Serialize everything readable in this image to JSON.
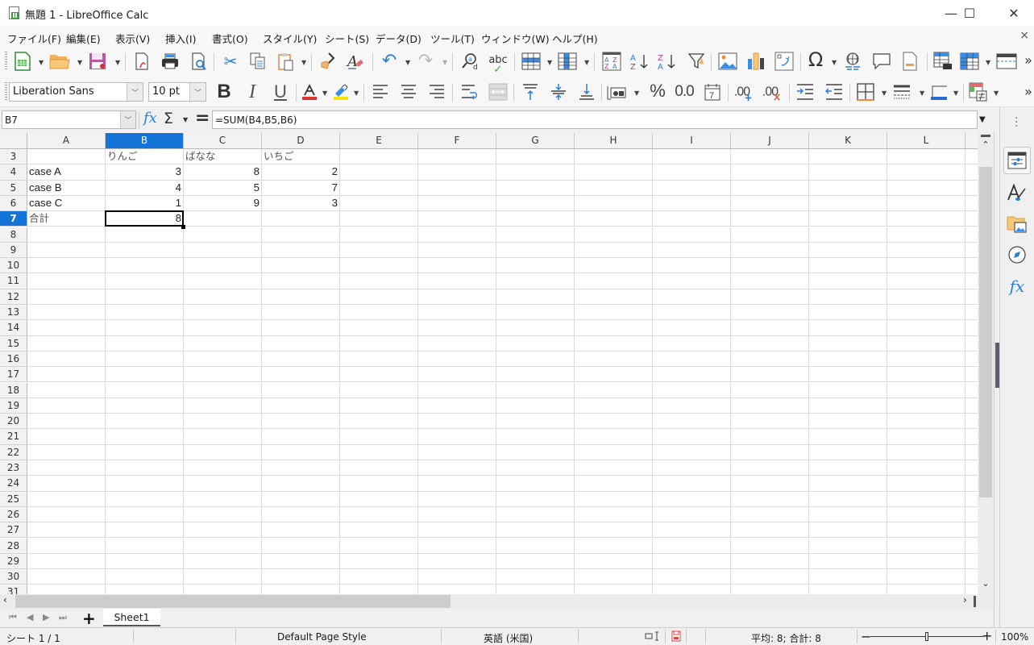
{
  "window": {
    "title": "無題 1 - LibreOffice Calc",
    "minimize_icon": "—",
    "maximize_icon": "☐",
    "close_icon": "✕"
  },
  "menu": {
    "items": [
      {
        "label": "ファイル(F)"
      },
      {
        "label": "編集(E)"
      },
      {
        "label": "表示(V)"
      },
      {
        "label": "挿入(I)"
      },
      {
        "label": "書式(O)"
      },
      {
        "label": "スタイル(Y)"
      },
      {
        "label": "シート(S)"
      },
      {
        "label": "データ(D)"
      },
      {
        "label": "ツール(T)"
      },
      {
        "label": "ウィンドウ(W)"
      },
      {
        "label": "ヘルプ(H)"
      }
    ],
    "close_doc_icon": "×"
  },
  "toolbar1": {
    "icons": [
      "new-spreadsheet-icon",
      "open-folder-icon",
      "save-icon",
      "export-pdf-icon",
      "print-icon",
      "print-preview-icon",
      "cut-icon",
      "copy-icon",
      "paste-icon",
      "clone-formatting-icon",
      "clear-formatting-icon",
      "undo-icon",
      "redo-icon",
      "find-replace-icon",
      "spellcheck-icon",
      "row-icon",
      "column-icon",
      "autofilter-sort-icon",
      "sort-ascending-icon",
      "sort-descending-icon",
      "autofilter-icon",
      "insert-image-icon",
      "insert-chart-icon",
      "pivot-table-icon",
      "special-character-icon",
      "hyperlink-icon",
      "comment-icon",
      "header-footer-icon",
      "define-print-area-icon",
      "freeze-rows-columns-icon",
      "split-window-icon"
    ],
    "glyphs": {
      "undo": "↶",
      "redo": "↷",
      "cut": "✂",
      "omega": "Ω",
      "sort_asc": "A↓",
      "sort_desc": "Z↓",
      "spell": "abc",
      "overflow": "»"
    }
  },
  "toolbar2": {
    "font_name": "Liberation Sans",
    "font_size": "10 pt",
    "bold": "B",
    "italic": "I",
    "underline": "U",
    "font_color": "#e03030",
    "highlight_color": "#f5e600",
    "percent": "%",
    "number_format": "0.0",
    "add_decimal": ".00",
    "remove_decimal": ".00",
    "date_glyph": "7",
    "overflow": "»"
  },
  "formula_bar": {
    "name_box": "B7",
    "fx_label": "fx",
    "sum_label": "Σ",
    "equals_label": "=",
    "formula": "=SUM(B4,B5,B6)"
  },
  "grid": {
    "columns": [
      "A",
      "B",
      "C",
      "D",
      "E",
      "F",
      "G",
      "H",
      "I",
      "J",
      "K",
      "L"
    ],
    "selected_column": "B",
    "rows": [
      3,
      4,
      5,
      6,
      7,
      8,
      9,
      10,
      11,
      12,
      13,
      14,
      15,
      16,
      17,
      18,
      19,
      20,
      21,
      22,
      23,
      24,
      25,
      26,
      27,
      28,
      29,
      30,
      31
    ],
    "selected_row": 7,
    "cells": [
      {
        "row": 3,
        "col": "B",
        "value": "りんご",
        "type": "text"
      },
      {
        "row": 3,
        "col": "C",
        "value": "ばなな",
        "type": "text"
      },
      {
        "row": 3,
        "col": "D",
        "value": "いちご",
        "type": "text"
      },
      {
        "row": 4,
        "col": "A",
        "value": "case A",
        "type": "text"
      },
      {
        "row": 4,
        "col": "B",
        "value": "3",
        "type": "number"
      },
      {
        "row": 4,
        "col": "C",
        "value": "8",
        "type": "number"
      },
      {
        "row": 4,
        "col": "D",
        "value": "2",
        "type": "number"
      },
      {
        "row": 5,
        "col": "A",
        "value": "case B",
        "type": "text"
      },
      {
        "row": 5,
        "col": "B",
        "value": "4",
        "type": "number"
      },
      {
        "row": 5,
        "col": "C",
        "value": "5",
        "type": "number"
      },
      {
        "row": 5,
        "col": "D",
        "value": "7",
        "type": "number"
      },
      {
        "row": 6,
        "col": "A",
        "value": "case C",
        "type": "text"
      },
      {
        "row": 6,
        "col": "B",
        "value": "1",
        "type": "number"
      },
      {
        "row": 6,
        "col": "C",
        "value": "9",
        "type": "number"
      },
      {
        "row": 6,
        "col": "D",
        "value": "3",
        "type": "number"
      },
      {
        "row": 7,
        "col": "A",
        "value": "合計",
        "type": "text"
      },
      {
        "row": 7,
        "col": "B",
        "value": "8",
        "type": "number"
      }
    ],
    "active_cell": "B7"
  },
  "sheet_tabs": {
    "add_label": "+",
    "tabs": [
      {
        "label": "Sheet1",
        "active": true
      }
    ]
  },
  "sidebar": {
    "items": [
      "properties-icon",
      "styles-icon",
      "gallery-icon",
      "navigator-icon",
      "functions-icon"
    ]
  },
  "status_bar": {
    "sheet_position": "シート 1 / 1",
    "page_style": "Default Page Style",
    "language": "英語 (米国)",
    "selection_summary": "平均: 8; 合計: 8",
    "zoom_level": "100%",
    "zoom_fraction": 0.5
  },
  "colors": {
    "selection_blue": "#1473d7",
    "header_gray": "#f2f2f2"
  }
}
